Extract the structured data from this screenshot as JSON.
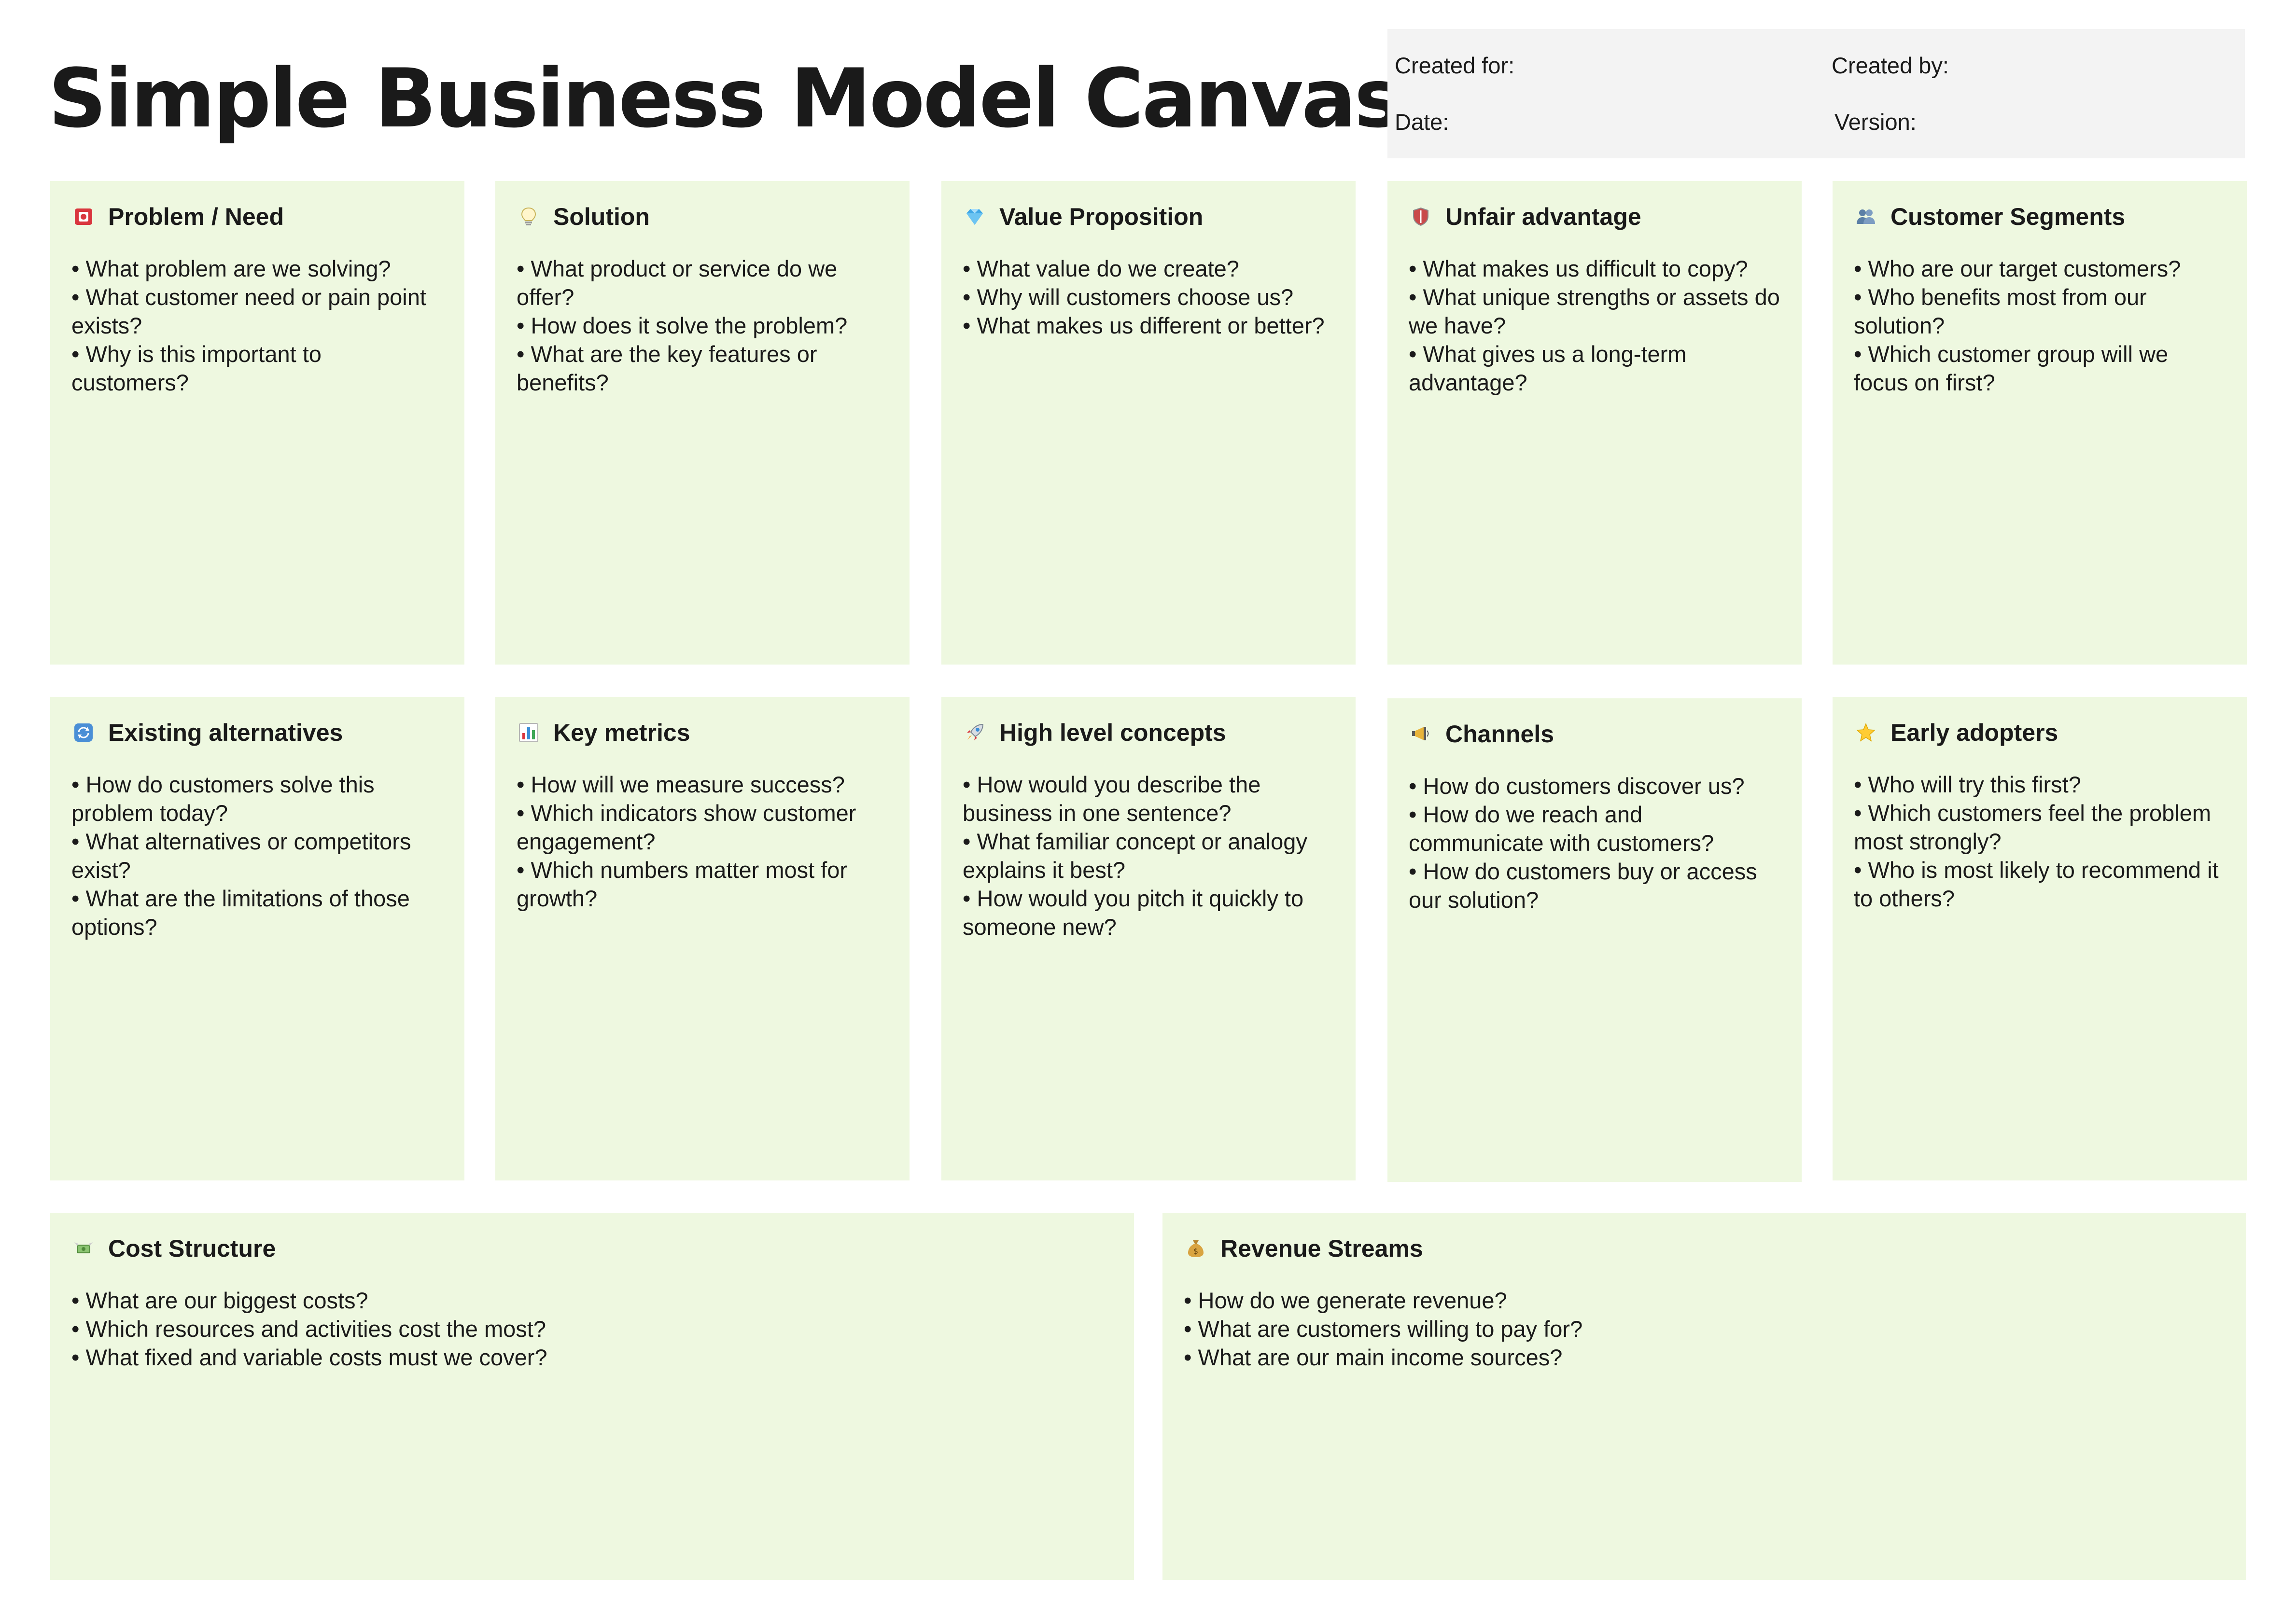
{
  "title": "Simple Business Model Canvas",
  "meta": {
    "created_for": "Created for:",
    "created_by": "Created by:",
    "date": "Date:",
    "version": "Version:"
  },
  "colors": {
    "card_background": "#eef8e0",
    "meta_background": "#f3f3f3",
    "text": "#1a1a1a"
  },
  "cards": {
    "problem": {
      "icon": "siren-icon",
      "title": "Problem / Need",
      "lines": [
        "• What problem are we solving?",
        "• What customer need or pain point exists?",
        "• Why is this important to customers?"
      ]
    },
    "solution": {
      "icon": "lightbulb-icon",
      "title": "Solution",
      "lines": [
        "• What product or service do we offer?",
        "• How does it solve the problem?",
        "• What are the key features or benefits?"
      ]
    },
    "value_proposition": {
      "icon": "gem-icon",
      "title": "Value Proposition",
      "lines": [
        "• What value do we create?",
        "• Why will customers choose us?",
        "• What makes us different or better?"
      ]
    },
    "unfair_advantage": {
      "icon": "shield-icon",
      "title": "Unfair advantage",
      "lines": [
        "• What makes us difficult to copy?",
        "• What unique strengths or assets do we have?",
        "• What gives us a long-term advantage?"
      ]
    },
    "customer_segments": {
      "icon": "people-icon",
      "title": "Customer Segments",
      "lines": [
        "• Who are our target customers?",
        "• Who benefits most from our solution?",
        "• Which customer group will we focus on first?"
      ]
    },
    "existing_alternatives": {
      "icon": "cycle-arrows-icon",
      "title": "Existing alternatives",
      "lines": [
        "• How do customers solve this problem today?",
        "• What alternatives or competitors exist?",
        "• What are the limitations of those options?"
      ]
    },
    "key_metrics": {
      "icon": "bar-chart-icon",
      "title": "Key metrics",
      "lines": [
        "• How will we measure success?",
        "• Which indicators show customer engagement?",
        "• Which numbers matter most for growth?"
      ]
    },
    "high_level_concepts": {
      "icon": "rocket-icon",
      "title": "High level concepts",
      "lines": [
        "• How would you describe the business in one sentence?",
        "• What familiar concept or analogy explains it best?",
        "• How would you pitch it quickly to someone new?"
      ]
    },
    "channels": {
      "icon": "megaphone-icon",
      "title": "Channels",
      "lines": [
        "• How do customers discover us?",
        "• How do we reach and communicate with customers?",
        "• How do customers buy or access our solution?"
      ]
    },
    "early_adopters": {
      "icon": "star-icon",
      "title": "Early adopters",
      "lines": [
        "• Who will try this first?",
        "• Which customers feel the problem most strongly?",
        "• Who is most likely to recommend it to others?"
      ]
    },
    "cost_structure": {
      "icon": "money-wings-icon",
      "title": "Cost Structure",
      "lines": [
        "• What are our biggest costs?",
        "• Which resources and activities cost the most?",
        "• What fixed and variable costs must we cover?"
      ]
    },
    "revenue_streams": {
      "icon": "money-bag-icon",
      "title": "Revenue Streams",
      "lines": [
        "• How do we generate revenue?",
        "• What are customers willing to pay for?",
        "• What are our main income sources?"
      ]
    }
  }
}
